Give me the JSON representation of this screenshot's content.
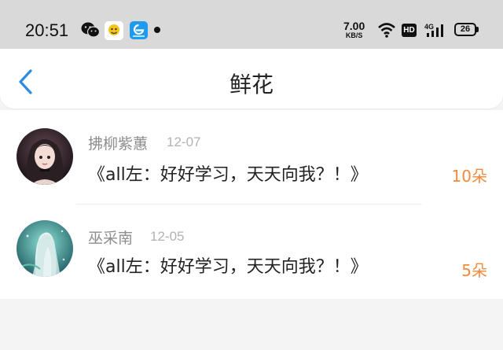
{
  "status_bar": {
    "time": "20:51",
    "net_speed_value": "7.00",
    "net_speed_unit": "KB/S",
    "hd_label": "HD",
    "network_label": "4G",
    "battery": "26",
    "icons": [
      "wechat-icon",
      "app-icon",
      "app-icon",
      "dot-icon",
      "wifi-icon",
      "signal-icon",
      "battery-icon"
    ]
  },
  "header": {
    "title": "鲜花",
    "back_icon": "chevron-left-icon",
    "accent_color": "#2a8de0"
  },
  "list": [
    {
      "name": "拂柳紫蕙",
      "date": "12-07",
      "message": "《all左：好好学习，天天向我？！》",
      "count": "10朵"
    },
    {
      "name": "巫采南",
      "date": "12-05",
      "message": "《all左：好好学习，天天向我？！》",
      "count": "5朵"
    }
  ],
  "colors": {
    "count": "#f08a3c",
    "name": "#8e8e8e",
    "date": "#b2b2b2"
  }
}
